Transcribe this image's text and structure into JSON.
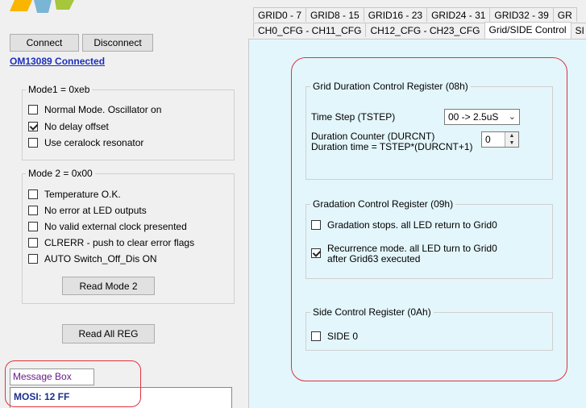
{
  "toolbar": {
    "connect_label": "Connect",
    "disconnect_label": "Disconnect",
    "status": "OM13089 Connected"
  },
  "mode1": {
    "title": "Mode1 = 0xeb",
    "items": [
      {
        "label": "Normal Mode. Oscillator on",
        "checked": false
      },
      {
        "label": "No delay offset",
        "checked": true
      },
      {
        "label": "Use ceralock resonator",
        "checked": false
      }
    ]
  },
  "mode2": {
    "title": "Mode 2 = 0x00",
    "items": [
      {
        "label": "Temperature O.K.",
        "checked": false
      },
      {
        "label": "No error at LED outputs",
        "checked": false
      },
      {
        "label": "No valid external clock presented",
        "checked": false
      },
      {
        "label": "CLRERR - push to clear error flags",
        "checked": false
      },
      {
        "label": "AUTO Switch_Off_Dis ON",
        "checked": false
      }
    ],
    "read_button": "Read Mode 2"
  },
  "read_all_button": "Read All REG",
  "message": {
    "label": "Message Box",
    "text": "MOSI: 12 FF"
  },
  "tabs": {
    "row1": [
      "GRID0 - 7",
      "GRID8 - 15",
      "GRID16 - 23",
      "GRID24 - 31",
      "GRID32 - 39",
      "GR"
    ],
    "row2": [
      "CH0_CFG - CH11_CFG",
      "CH12_CFG - CH23_CFG",
      "Grid/SIDE Control",
      "SI"
    ],
    "active": "Grid/SIDE Control"
  },
  "grid_duration": {
    "title": "Grid Duration Control Register (08h)",
    "tstep_label": "Time Step (TSTEP)",
    "tstep_value": "00 -> 2.5uS",
    "durcnt_label": "Duration Counter (DURCNT)",
    "duration_label": "Duration time = TSTEP*(DURCNT+1)",
    "durcnt_value": "0"
  },
  "gradation": {
    "title": "Gradation Control Register (09h)",
    "stops_label": "Gradation stops. all LED return to Grid0",
    "stops_checked": false,
    "recurrence_label_1": "Recurrence mode. all LED turn to Grid0",
    "recurrence_label_2": "after Grid63 executed",
    "recurrence_checked": true
  },
  "side": {
    "title": "Side Control Register (0Ah)",
    "side0_label": "SIDE 0",
    "side0_checked": false
  },
  "colors": {
    "panel_bg": "#e3f6fb",
    "status_blue": "#1a2fbf",
    "annotation_red": "#e0323c",
    "message_label": "#6a1b8a",
    "message_text": "#1a2f8f"
  }
}
